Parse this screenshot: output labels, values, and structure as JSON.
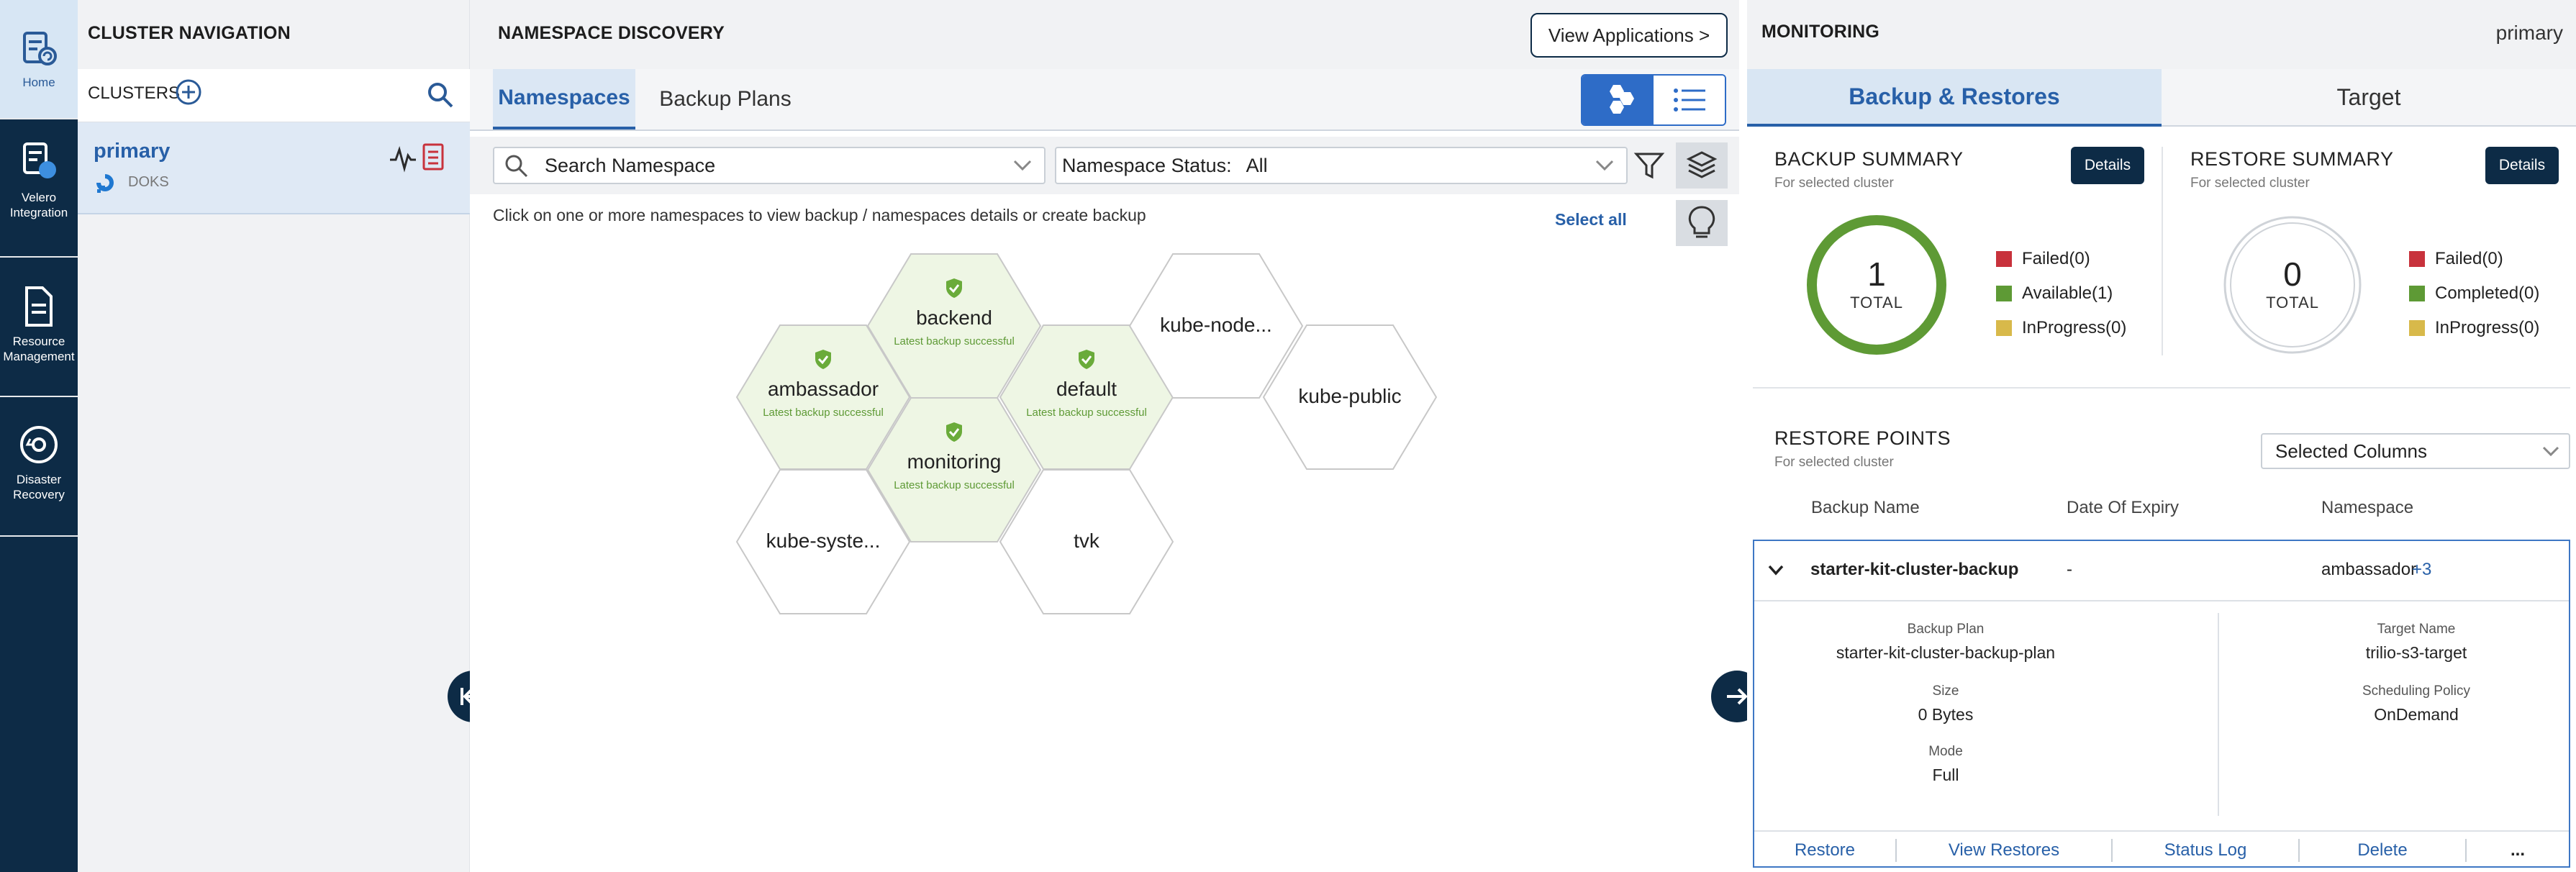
{
  "rail": {
    "items": [
      {
        "label": "Home",
        "icon": "home-icon"
      },
      {
        "label": "Velero Integration",
        "icon": "velero-icon"
      },
      {
        "label": "Resource Management",
        "icon": "document-icon"
      },
      {
        "label": "Disaster Recovery",
        "icon": "disaster-recovery-icon"
      }
    ]
  },
  "cluster_nav": {
    "title": "CLUSTER NAVIGATION",
    "clusters_label": "CLUSTERS",
    "cluster": {
      "name": "primary",
      "provider": "DOKS"
    }
  },
  "namespace_discovery": {
    "title": "NAMESPACE DISCOVERY",
    "view_applications": "View Applications >",
    "tabs": [
      "Namespaces",
      "Backup Plans"
    ],
    "search_placeholder": "Search Namespace",
    "status_label": "Namespace Status:",
    "status_value": "All",
    "hint": "Click on one or more namespaces to view backup / namespaces details or create backup",
    "select_all": "Select all",
    "namespaces": [
      {
        "name": "backend",
        "status": "Latest backup successful",
        "backed_up": true
      },
      {
        "name": "ambassador",
        "status": "Latest backup successful",
        "backed_up": true
      },
      {
        "name": "default",
        "status": "Latest backup successful",
        "backed_up": true
      },
      {
        "name": "monitoring",
        "status": "Latest backup successful",
        "backed_up": true
      },
      {
        "name": "kube-node...",
        "status": "",
        "backed_up": false
      },
      {
        "name": "kube-public",
        "status": "",
        "backed_up": false
      },
      {
        "name": "kube-syste...",
        "status": "",
        "backed_up": false
      },
      {
        "name": "tvk",
        "status": "",
        "backed_up": false
      }
    ]
  },
  "monitoring": {
    "title": "MONITORING",
    "cluster": "primary",
    "tabs": [
      "Backup & Restores",
      "Target"
    ],
    "backup_summary": {
      "title": "BACKUP SUMMARY",
      "subtitle": "For selected cluster",
      "details": "Details",
      "total": "1",
      "total_label": "TOTAL",
      "legend": [
        {
          "label": "Failed(0)",
          "color": "#c8323c"
        },
        {
          "label": "Available(1)",
          "color": "#5e9a35"
        },
        {
          "label": "InProgress(0)",
          "color": "#d8b94a"
        }
      ]
    },
    "restore_summary": {
      "title": "RESTORE SUMMARY",
      "subtitle": "For selected cluster",
      "details": "Details",
      "total": "0",
      "total_label": "TOTAL",
      "legend": [
        {
          "label": "Failed(0)",
          "color": "#c8323c"
        },
        {
          "label": "Completed(0)",
          "color": "#5e9a35"
        },
        {
          "label": "InProgress(0)",
          "color": "#d8b94a"
        }
      ]
    },
    "restore_points": {
      "title": "RESTORE POINTS",
      "subtitle": "For selected cluster",
      "columns_select": "Selected Columns",
      "headers": [
        "Backup Name",
        "Date Of Expiry",
        "Namespace"
      ],
      "row": {
        "backup_name": "starter-kit-cluster-backup",
        "expiry": "-",
        "namespace": "ambassador",
        "more": "+3"
      },
      "details": {
        "backup_plan_label": "Backup Plan",
        "backup_plan": "starter-kit-cluster-backup-plan",
        "size_label": "Size",
        "size": "0 Bytes",
        "mode_label": "Mode",
        "mode": "Full",
        "target_name_label": "Target Name",
        "target_name": "trilio-s3-target",
        "scheduling_label": "Scheduling Policy",
        "scheduling": "OnDemand"
      },
      "actions": [
        "Restore",
        "View Restores",
        "Status Log",
        "Delete",
        "..."
      ]
    }
  },
  "colors": {
    "navy": "#0d2b46",
    "accent": "#2860a8",
    "success_green": "#5e9a35",
    "hex_fill_success": "#eef6e4"
  }
}
